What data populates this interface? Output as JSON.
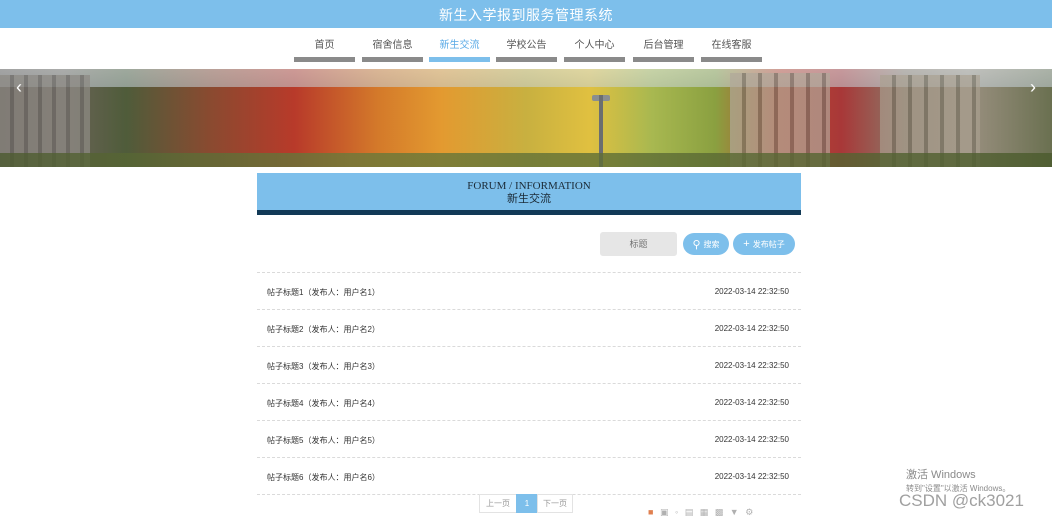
{
  "header": {
    "title": "新生入学报到服务管理系统"
  },
  "nav": {
    "items": [
      {
        "label": "首页"
      },
      {
        "label": "宿舍信息"
      },
      {
        "label": "新生交流",
        "active": true
      },
      {
        "label": "学校公告"
      },
      {
        "label": "个人中心"
      },
      {
        "label": "后台管理"
      },
      {
        "label": "在线客服"
      }
    ]
  },
  "banner": {
    "prev_arrow": "‹",
    "next_arrow": "›"
  },
  "section": {
    "title_en": "FORUM / INFORMATION",
    "title_cn": "新生交流"
  },
  "search": {
    "placeholder": "标题",
    "search_label": "搜索",
    "post_label": "发布帖子"
  },
  "posts": [
    {
      "title": "帖子标题1（发布人：用户名1）",
      "date": "2022-03-14 22:32:50"
    },
    {
      "title": "帖子标题2（发布人：用户名2）",
      "date": "2022-03-14 22:32:50"
    },
    {
      "title": "帖子标题3（发布人：用户名3）",
      "date": "2022-03-14 22:32:50"
    },
    {
      "title": "帖子标题4（发布人：用户名4）",
      "date": "2022-03-14 22:32:50"
    },
    {
      "title": "帖子标题5（发布人：用户名5）",
      "date": "2022-03-14 22:32:50"
    },
    {
      "title": "帖子标题6（发布人：用户名6）",
      "date": "2022-03-14 22:32:50"
    }
  ],
  "pagination": {
    "prev": "上一页",
    "current": "1",
    "next": "下一页"
  },
  "watermark": {
    "activate_title": "激活 Windows",
    "activate_sub": "转到\"设置\"以激活 Windows。",
    "csdn": "CSDN @ck3021"
  },
  "colors": {
    "accent": "#7dbfeb",
    "heading_border": "#123a57",
    "nav_bar": "#8a8a8a"
  }
}
